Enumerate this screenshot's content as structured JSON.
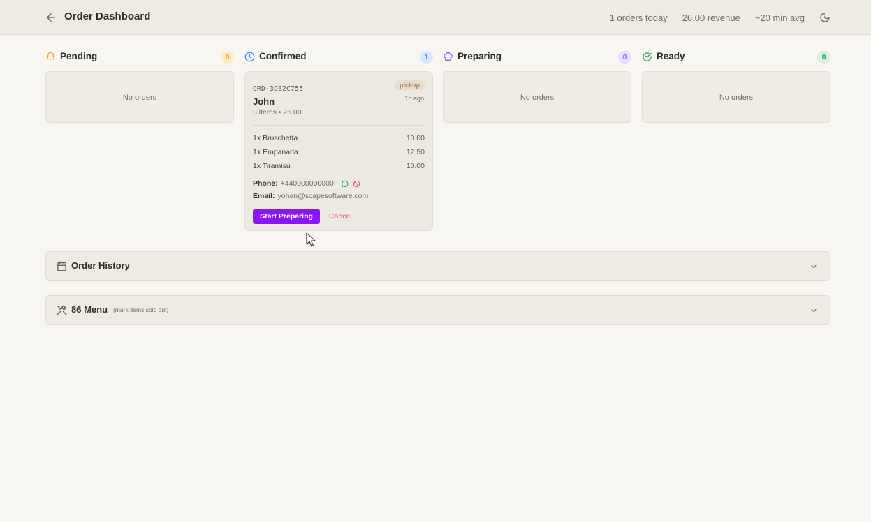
{
  "header": {
    "title": "Order Dashboard",
    "stats": [
      "1 orders today",
      "26.00 revenue",
      "~20 min avg"
    ],
    "back_icon": "arrow-left-icon",
    "theme_icon": "moon-icon"
  },
  "columns": [
    {
      "label": "Pending",
      "count": "0",
      "icon": "bell-icon",
      "color": "#f0a020",
      "badge_bg": "#fdecc8",
      "empty_text": "No orders"
    },
    {
      "label": "Confirmed",
      "count": "1",
      "icon": "clock-icon",
      "color": "#3b82f6",
      "badge_bg": "#dbe6fb"
    },
    {
      "label": "Preparing",
      "count": "0",
      "icon": "chef-hat-icon",
      "color": "#8b5cf6",
      "badge_bg": "#e9defb",
      "empty_text": "No orders"
    },
    {
      "label": "Ready",
      "count": "0",
      "icon": "check-circle-icon",
      "color": "#22a55a",
      "badge_bg": "#d7f2e0",
      "empty_text": "No orders"
    }
  ],
  "order": {
    "id": "ORD-3DB2C755",
    "type": "pickup",
    "time_ago": "1h ago",
    "customer": "John",
    "summary": "3 items • 26.00",
    "items": [
      {
        "name": "1x Bruschetta",
        "price": "10.00"
      },
      {
        "name": "1x Empanada",
        "price": "12.50"
      },
      {
        "name": "1x Tiramisu",
        "price": "10.00"
      }
    ],
    "phone_label": "Phone:",
    "phone": "+440000000000",
    "email_label": "Email:",
    "email": "yohan@scapesoftware.com",
    "start_label": "Start Preparing",
    "cancel_label": "Cancel",
    "accent": "#8a16f0"
  },
  "sections": [
    {
      "title": "Order History",
      "subtitle": "",
      "icon": "calendar-icon"
    },
    {
      "title": "86 Menu",
      "subtitle": "(mark items sold out)",
      "icon": "utensils-crossed-icon"
    }
  ]
}
